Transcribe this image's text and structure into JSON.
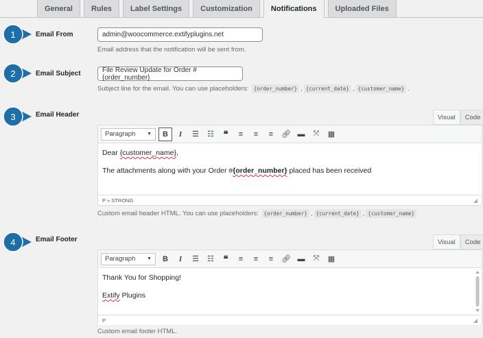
{
  "tabs": [
    {
      "label": "General"
    },
    {
      "label": "Rules"
    },
    {
      "label": "Label Settings"
    },
    {
      "label": "Customization"
    },
    {
      "label": "Notifications"
    },
    {
      "label": "Uploaded Files"
    }
  ],
  "steps": [
    "1",
    "2",
    "3",
    "4"
  ],
  "email_from": {
    "label": "Email From",
    "value": "admin@woocommerce.extifyplugins.net",
    "description": "Email address that the notification will be sent from."
  },
  "email_subject": {
    "label": "Email Subject",
    "value": "File Review Update for Order #{order_number}",
    "description_prefix": "Subject line for the email. You can use placeholders:",
    "placeholders": [
      "{order_number}",
      "{current_date}",
      "{customer_name}"
    ],
    "sep": ",",
    "end": "."
  },
  "email_header": {
    "label": "Email Header",
    "visual_tab": "Visual",
    "code_tab": "Code",
    "format": "Paragraph",
    "line1_prefix": "Dear ",
    "line1_word": "{customer_name}",
    "line1_suffix": ",",
    "line2_prefix": "The attachments along with your Order #",
    "line2_bold": "{order_number}",
    "line2_suffix": " placed has been received",
    "status": "P » STRONG",
    "description_prefix": "Custom email header HTML. You can use placeholders:",
    "placeholders": [
      "{order_number}",
      "{current_date}",
      "{customer_name}"
    ],
    "sep": ","
  },
  "email_footer": {
    "label": "Email Footer",
    "visual_tab": "Visual",
    "code_tab": "Code",
    "format": "Paragraph",
    "line1": "Thank You for Shopping!",
    "line2": "Extify",
    "line2_suffix": " Plugins",
    "status": "P",
    "description": "Custom email footer HTML."
  },
  "colors": {
    "step_badge": "#1e6fa8",
    "accent": "#2271b1"
  }
}
